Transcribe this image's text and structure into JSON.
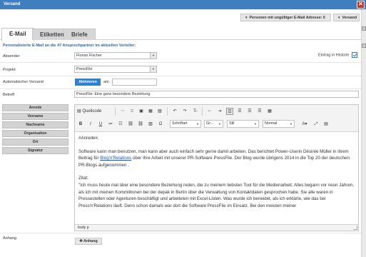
{
  "window": {
    "title": "Versand"
  },
  "top_buttons": {
    "invalid_email": "Personen mit ungültiger E-Mail Adresse: 0",
    "send": "Versand"
  },
  "tabs": [
    {
      "label": "E-Mail",
      "active": true
    },
    {
      "label": "Etiketten",
      "active": false
    },
    {
      "label": "Briefe",
      "active": false
    }
  ],
  "subtitle": "Personalisierte E-Mail an die 47 Ansprechpartner im aktuellen Verteiler:",
  "form": {
    "absender_label": "Absender",
    "absender_value": "Florian Fischer",
    "historie_label": "Eintrag in Historie",
    "historie_checked": true,
    "projekt_label": "Projekt:",
    "projekt_value": "PressFile",
    "auto_label": "Automatischer Versand",
    "activate_btn": "Aktivieren",
    "am_label": "am:",
    "am_value": "",
    "betreff_label": "Betreff",
    "betreff_value": "PressFile: Eine ganz besondere Beziehung",
    "anhang_label": "Anhang",
    "anhang_btn": "Anhang"
  },
  "placeholders": [
    "Anrede",
    "Vorname",
    "Nachname",
    "Organisation",
    "Ort",
    "Signatur"
  ],
  "editor": {
    "source_label": "Quellcode",
    "font_label": "Schriftart",
    "size_label": "Gr...",
    "style_label": "Stil",
    "format_label": "Normal",
    "paragraphs": {
      "p1": "#Anrede#,",
      "p2_pre": "Software kann man benutzen, man kann aber auch einfach sehr gerne damit arbeiten. Das berichtet Power-Userin Désirée Müller in ihrem Beitrag für ",
      "p2_link": "Blog'n'Relations",
      "p2_post": " über Ihre Arbeit mit unserer PR-Software PressFile. Der Blog wurde übrigens 2014 in die Top 20 der deutschen PR-Blogs aufgenommen .",
      "p3_head": "Zitat:",
      "p3": "\"Ich muss heute mal über eine besondere Beziehung reden, die zu meinem liebsten Tool für die Medienarbeit. Alles begann vor neun Jahren, als ich mit meinen Kommilitonen bei der depak in Berlin über die Verwaltung von Kontaktdaten gesprochen habe. Sie alle waren in Pressestellen oder Agenturen beschäftigt und arbeiteten mit Excel-Listen. Was wurde ich beneidet, als ich erklärte, wie das bei Press'n'Relations läuft. Denn schon damals war dort die Software PressFile im Einsatz. Bei den meisten meiner"
    },
    "statusbar": "body  p"
  }
}
